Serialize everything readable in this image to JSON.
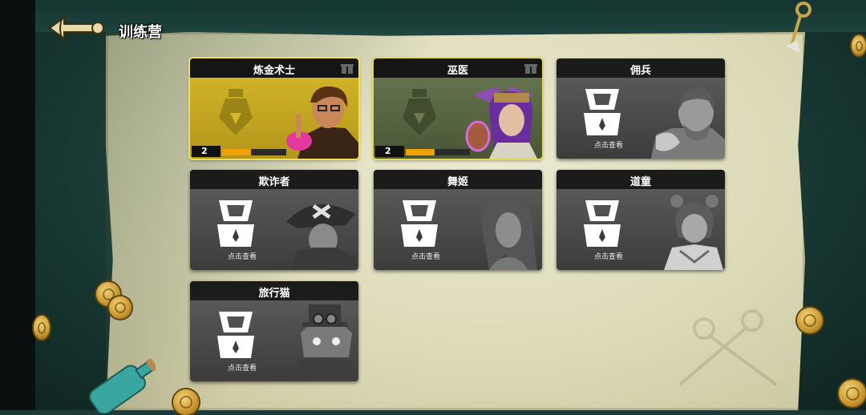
{
  "header": {
    "title": "训练营"
  },
  "cards": [
    {
      "name": "炼金术士",
      "locked": false,
      "level": "2",
      "progress": 0.45,
      "theme": "#d6b92a"
    },
    {
      "name": "巫医",
      "locked": false,
      "level": "2",
      "progress": 0.45,
      "theme": "#6a7a52"
    },
    {
      "name": "佣兵",
      "locked": true,
      "hint": "点击查看"
    },
    {
      "name": "欺诈者",
      "locked": true,
      "hint": "点击查看"
    },
    {
      "name": "舞姬",
      "locked": true,
      "hint": "点击查看"
    },
    {
      "name": "道童",
      "locked": true,
      "hint": "点击查看"
    },
    {
      "name": "旅行猫",
      "locked": true,
      "hint": "点击查看"
    }
  ],
  "icons": {
    "back": "anchor-back-icon",
    "locked_silhouette": "lock-badge-icon",
    "unlocked_silhouette": "potion-icon",
    "gift": "gift-icon"
  },
  "colors": {
    "progress_fill": "#f0a000",
    "gold_border": "#f2dd5c"
  }
}
